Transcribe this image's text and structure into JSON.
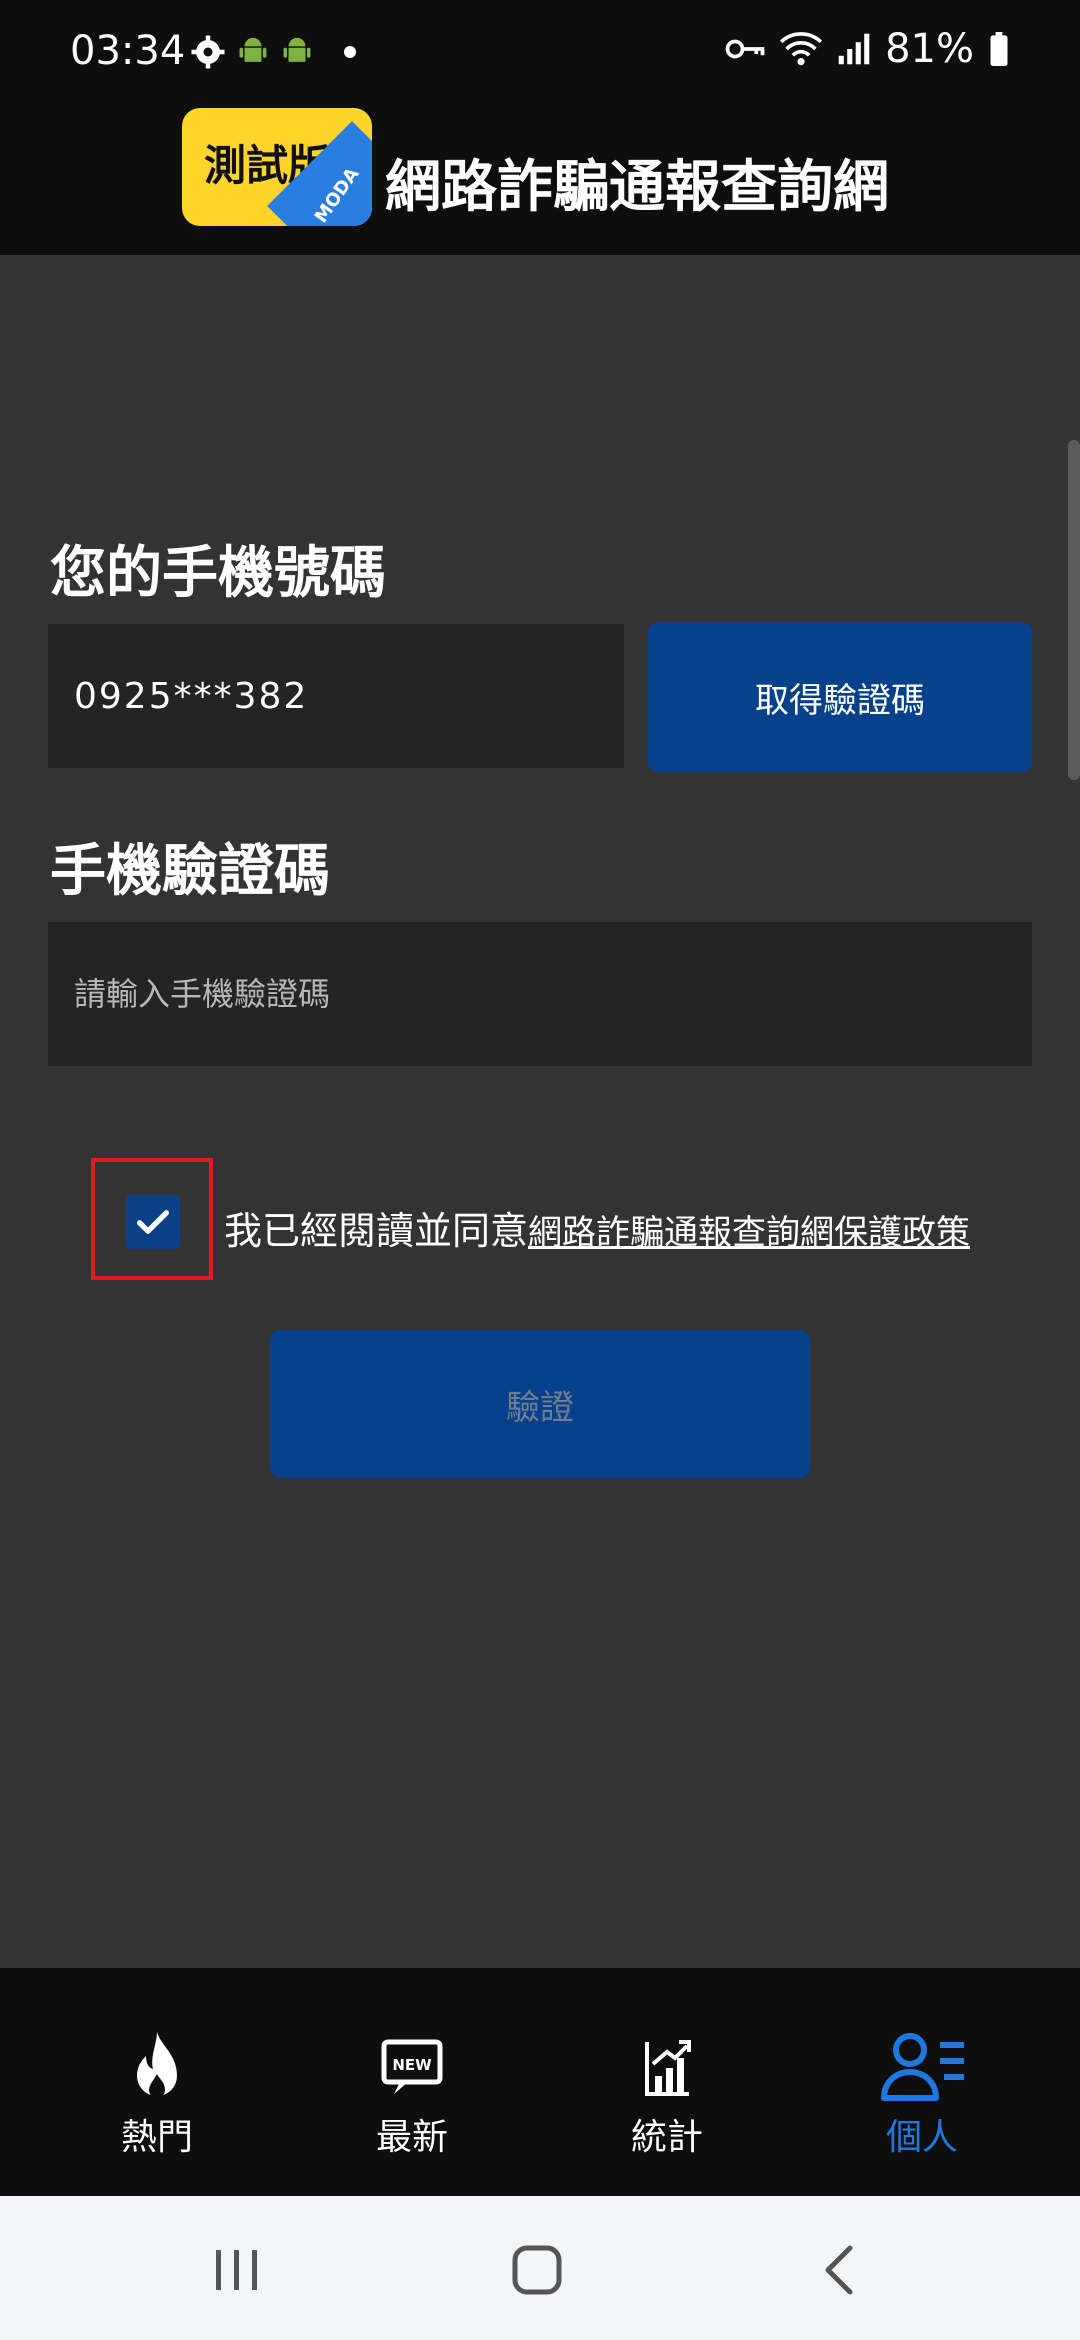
{
  "status_bar": {
    "time": "03:34",
    "battery": "81%"
  },
  "header": {
    "logo_text": "測試版",
    "logo_corner": "MODA",
    "title": "網路詐騙通報查詢網"
  },
  "form": {
    "phone_label": "您的手機號碼",
    "phone_value": "0925***382",
    "get_code_button": "取得驗證碼",
    "code_label": "手機驗證碼",
    "code_placeholder": "請輸入手機驗證碼",
    "consent_text": "我已經閱讀並同意",
    "policy_link": "網路詐騙通報查詢網保護政策",
    "verify_button": "驗證"
  },
  "bottom_nav": {
    "items": [
      {
        "label": "熱門",
        "icon": "flame-icon"
      },
      {
        "label": "最新",
        "icon": "new-icon"
      },
      {
        "label": "統計",
        "icon": "stats-icon"
      },
      {
        "label": "個人",
        "icon": "user-list-icon"
      }
    ],
    "active_color": "#1f78e0"
  },
  "colors": {
    "primary_button": "#07418c",
    "highlight_border": "#e01b1b"
  }
}
